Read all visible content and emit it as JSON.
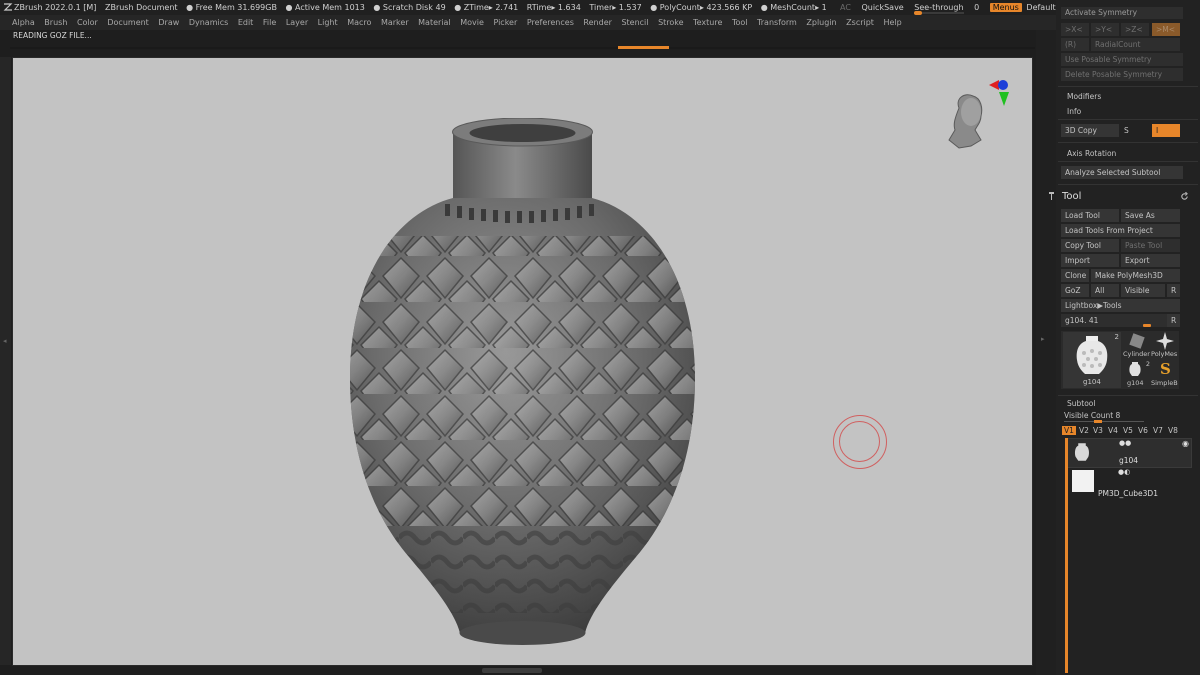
{
  "titlebar": {
    "app_title": "ZBrush 2022.0.1 [M]",
    "document": "ZBrush Document",
    "free_mem": "● Free Mem 31.699GB",
    "active_mem": "● Active Mem 1013",
    "scratch_disk": "● Scratch Disk 49",
    "ztime": "● ZTime▸ 2.741",
    "rtime": "RTime▸ 1.634",
    "timer": "Timer▸ 1.537",
    "polycount": "● PolyCount▸ 423.566 KP",
    "meshcount": "● MeshCount▸ 1",
    "ac": "AC",
    "quicksave": "QuickSave",
    "see_through": "See-through",
    "see_through_value": "0",
    "menus": "Menus",
    "default_zscript": "DefaultZScript"
  },
  "menubar": [
    "Alpha",
    "Brush",
    "Color",
    "Document",
    "Draw",
    "Dynamics",
    "Edit",
    "File",
    "Layer",
    "Light",
    "Macro",
    "Marker",
    "Material",
    "Movie",
    "Picker",
    "Preferences",
    "Render",
    "Stencil",
    "Stroke",
    "Texture",
    "Tool",
    "Transform",
    "Zplugin",
    "Zscript",
    "Help"
  ],
  "notice": "READING GOZ FILE...",
  "panel": {
    "symmetry": {
      "activate": "Activate Symmetry",
      "x": ">X<",
      "y": ">Y<",
      "z": ">Z<",
      "m": ">M<",
      "r": "(R)",
      "radial_count": "RadialCount",
      "use_posable": "Use Posable Symmetry",
      "delete_posable": "Delete Posable Symmetry"
    },
    "modifiers": "Modifiers",
    "info": "Info",
    "copy3d": "3D Copy",
    "copy3d_s": "S",
    "copy3d_i": "I",
    "axis_rotation": "Axis Rotation",
    "analyze": "Analyze Selected Subtool",
    "tool_header": "Tool",
    "load_tool": "Load Tool",
    "save_as": "Save As",
    "load_from_project": "Load Tools From Project",
    "copy_tool": "Copy Tool",
    "paste_tool": "Paste Tool",
    "import": "Import",
    "export": "Export",
    "clone": "Clone",
    "make_polymesh": "Make PolyMesh3D",
    "goz": "GoZ",
    "all": "All",
    "visible": "Visible",
    "r": "R",
    "lightbox_tools": "Lightbox▶Tools",
    "tool_name": "g104. 41",
    "tool_name_r": "R",
    "thumbs": {
      "main_label": "g104",
      "main_count": "2",
      "cylinder": "Cylinder",
      "polymesh": "PolyMes",
      "small_label": "g104",
      "small_count": "2",
      "simple": "SimpleB"
    },
    "subtool_header": "Subtool",
    "visible_count": "Visible Count 8",
    "vtabs": [
      "V1",
      "V2",
      "V3",
      "V4",
      "V5",
      "V6",
      "V7",
      "V8"
    ],
    "subtools": [
      "g104",
      "PM3D_Cube3D1"
    ]
  },
  "colors": {
    "accent": "#e7862a",
    "viewport_bg": "#c3c3c3",
    "panel_bg": "#222222"
  }
}
